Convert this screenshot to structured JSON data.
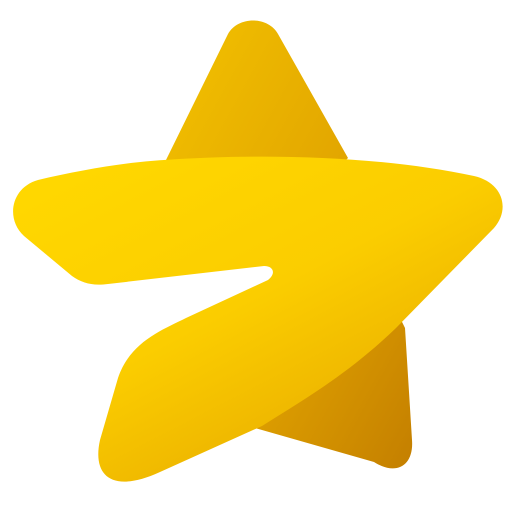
{
  "image": {
    "background_color": "#ffffff",
    "icon": {
      "name": "star-icon",
      "colors": {
        "light_gold": "#FFD400",
        "mid_gold": "#F2BC00",
        "dark_gold": "#D49600",
        "deep_gold": "#C47F00"
      }
    }
  }
}
